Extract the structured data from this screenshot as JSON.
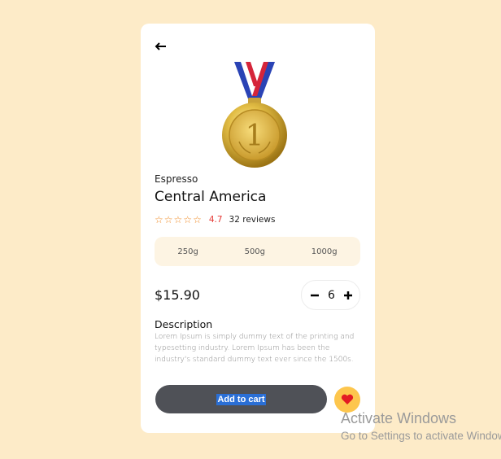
{
  "product": {
    "category": "Espresso",
    "name": "Central America",
    "rating": "4.7",
    "stars_filled": 0,
    "stars_total": 5,
    "reviews": "32 reviews",
    "price": "$15.90",
    "quantity": "6",
    "description_title": "Description",
    "description": "Lorem Ipsum is simply dummy text of the printing and typesetting industry. Lorem Ipsum has been the industry's standard dummy text ever since the 1500s."
  },
  "sizes": [
    {
      "label": "250g"
    },
    {
      "label": "500g"
    },
    {
      "label": "1000g"
    }
  ],
  "actions": {
    "add_to_cart": "Add to cart",
    "back_icon": "arrow-left-icon",
    "favorite_icon": "heart-icon",
    "minus_icon": "minus-icon",
    "plus_icon": "plus-icon"
  },
  "watermark": {
    "title": "Activate Windows",
    "subtitle": "Go to Settings to activate Windows."
  },
  "colors": {
    "page_bg": "#fdebc8",
    "button": "#4f5157",
    "favorite": "#fdc64d",
    "heart": "#e31b23",
    "star": "#f08a24",
    "rating": "#e53935"
  }
}
